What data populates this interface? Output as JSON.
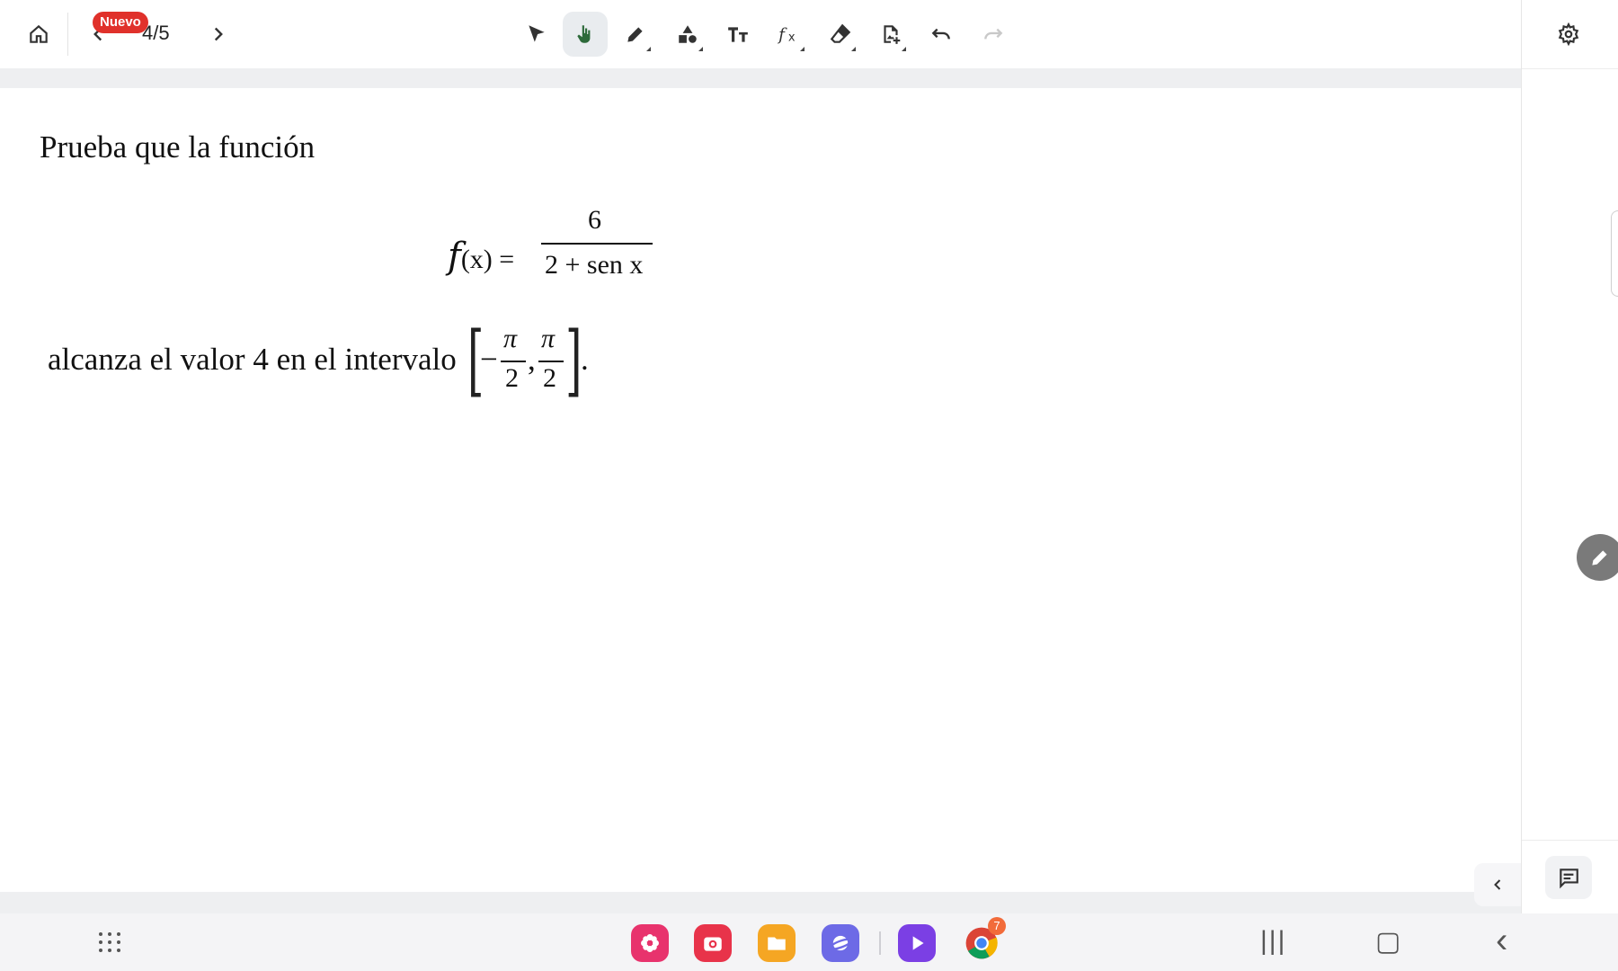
{
  "toolbar": {
    "home_icon": "home-icon",
    "badge": "Nuevo",
    "page_counter": "4/5",
    "tools": [
      {
        "name": "select",
        "icon": "arrow-pointer-icon"
      },
      {
        "name": "hand",
        "icon": "hand-icon",
        "active": true
      },
      {
        "name": "pen",
        "icon": "pen-icon"
      },
      {
        "name": "shapes",
        "icon": "shapes-icon"
      },
      {
        "name": "text",
        "icon": "text-icon"
      },
      {
        "name": "formula",
        "icon": "function-icon"
      },
      {
        "name": "eraser",
        "icon": "eraser-icon"
      },
      {
        "name": "add-image",
        "icon": "add-image-icon"
      },
      {
        "name": "undo",
        "icon": "undo-icon"
      },
      {
        "name": "redo",
        "icon": "redo-icon"
      }
    ],
    "settings_icon": "gear-icon",
    "accent_active_bg": "#e9ecef",
    "badge_color": "#e0312b"
  },
  "document": {
    "intro": "Prueba que la función",
    "formula": {
      "lhs_func": "f",
      "lhs_arg": "(x) =",
      "numerator": "6",
      "denominator": "2 + sen  x"
    },
    "statement": "alcanza el valor 4 en el intervalo",
    "interval": {
      "minus": "−",
      "pi": "π",
      "two": "2",
      "comma": ",",
      "period": "."
    }
  },
  "side": {
    "pen_fab_icon": "pencil-icon",
    "comment_icon": "comment-icon",
    "collapse_icon": "chevron-left-icon"
  },
  "taskbar": {
    "apps": [
      {
        "name": "flower-app",
        "color": "#e8336d"
      },
      {
        "name": "camera-app",
        "color": "#e8334a"
      },
      {
        "name": "files-app",
        "color": "#f5a623"
      },
      {
        "name": "browser-app",
        "color": "#6d6ae6"
      },
      {
        "name": "video-app",
        "color": "#7b3fe4"
      },
      {
        "name": "chrome-app",
        "color": "#ffffff",
        "badge": "7"
      }
    ],
    "nav": {
      "recents": "|||",
      "home": "▢",
      "back": "‹"
    }
  }
}
